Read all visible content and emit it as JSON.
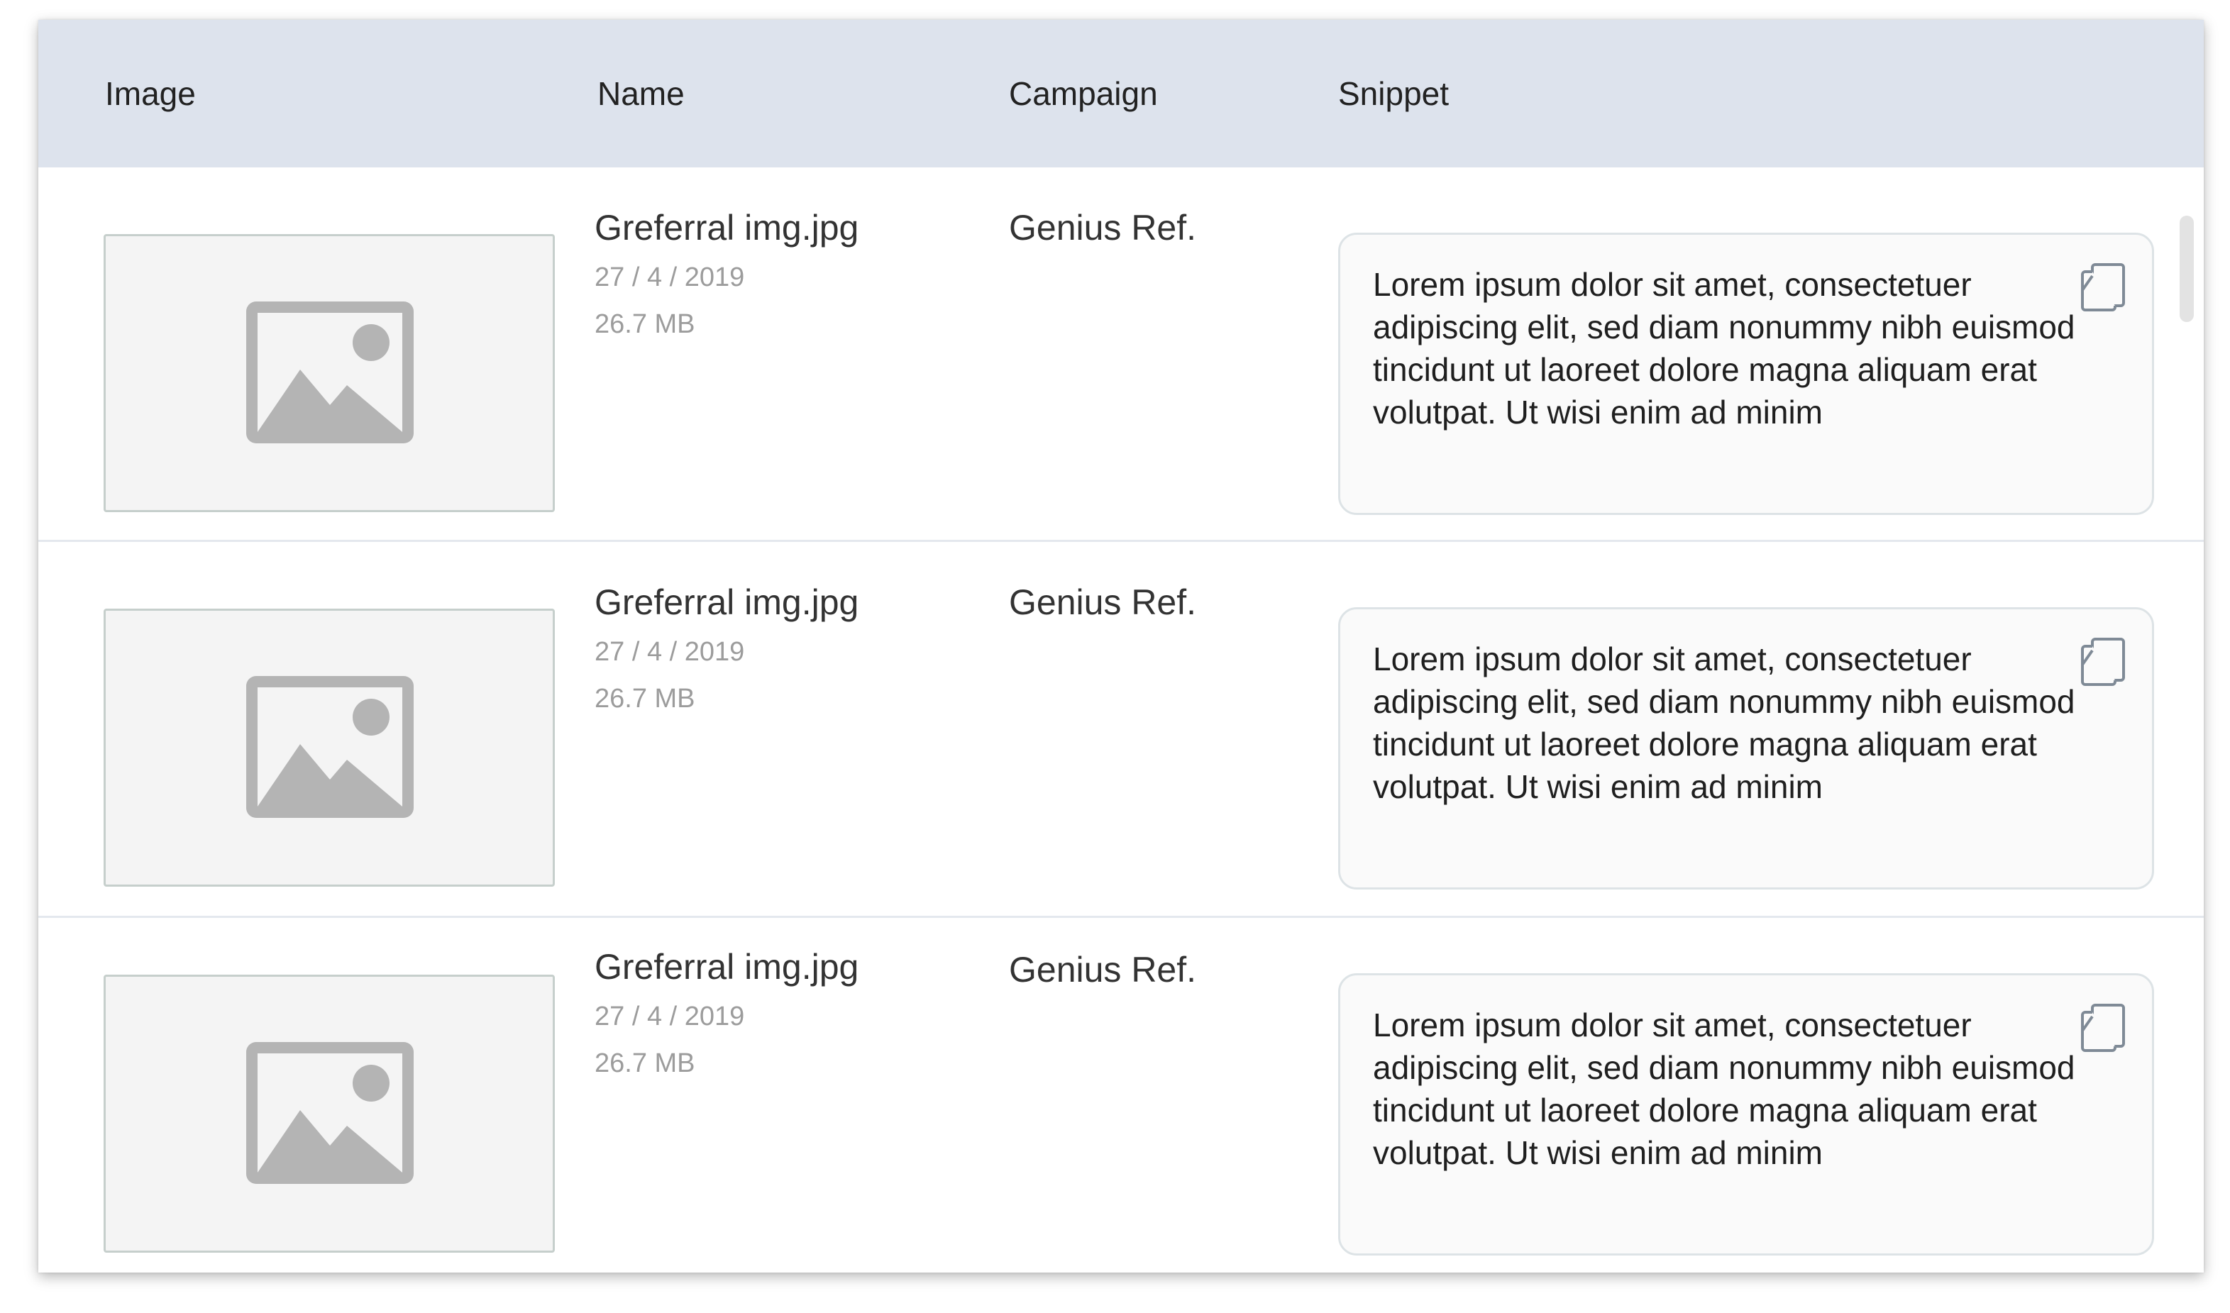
{
  "table": {
    "headers": {
      "image": "Image",
      "name": "Name",
      "campaign": "Campaign",
      "snippet": "Snippet"
    },
    "rows": [
      {
        "name": "Greferral img.jpg",
        "date": "27 / 4 / 2019",
        "size": "26.7 MB",
        "campaign": "Genius Ref.",
        "snippet": "Lorem ipsum dolor sit amet, consectetuer adipiscing elit, sed diam nonummy nibh euismod tincidunt ut laoreet dolore magna aliquam erat volutpat. Ut wisi enim ad minim",
        "thumbnail_icon": "image-placeholder-icon",
        "copy_icon": "copy-icon"
      },
      {
        "name": "Greferral img.jpg",
        "date": "27 / 4 / 2019",
        "size": "26.7 MB",
        "campaign": "Genius Ref.",
        "snippet": "Lorem ipsum dolor sit amet, consectetuer adipiscing elit, sed diam nonummy nibh euismod tincidunt ut laoreet dolore magna aliquam erat volutpat. Ut wisi enim ad minim",
        "thumbnail_icon": "image-placeholder-icon",
        "copy_icon": "copy-icon"
      },
      {
        "name": "Greferral img.jpg",
        "date": "27 / 4 / 2019",
        "size": "26.7 MB",
        "campaign": "Genius Ref.",
        "snippet": "Lorem ipsum dolor sit amet, consectetuer adipiscing elit, sed diam nonummy nibh euismod tincidunt ut laoreet dolore magna aliquam erat volutpat. Ut wisi enim ad minim",
        "thumbnail_icon": "image-placeholder-icon",
        "copy_icon": "copy-icon"
      }
    ]
  },
  "colors": {
    "header_background": "#dde3ed",
    "placeholder_icon": "#b4b4b4",
    "snippet_background": "#fafafa"
  }
}
